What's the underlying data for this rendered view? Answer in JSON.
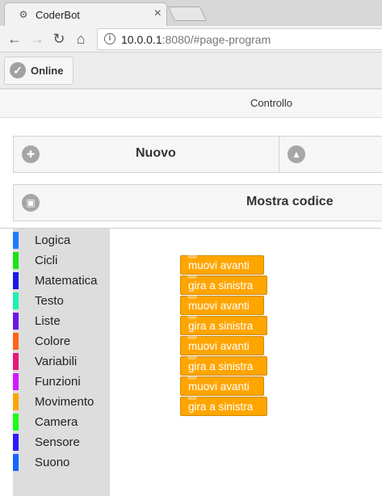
{
  "browser": {
    "tab_title": "CoderBot",
    "url_host": "10.0.0.1",
    "url_rest": ":8080/#page-program",
    "icons": [
      "back-arrow-icon",
      "forward-arrow-icon",
      "reload-icon",
      "home-icon",
      "info-icon",
      "close-icon"
    ]
  },
  "app": {
    "status_label": "Online",
    "tab_label": "Controllo",
    "buttons": {
      "new_label": "Nuovo",
      "show_code_label": "Mostra codice"
    }
  },
  "toolbox": {
    "categories": [
      {
        "label": "Logica",
        "color": "#1e7bff"
      },
      {
        "label": "Cicli",
        "color": "#18e418"
      },
      {
        "label": "Matematica",
        "color": "#1a1ae6"
      },
      {
        "label": "Testo",
        "color": "#1ef0b4"
      },
      {
        "label": "Liste",
        "color": "#6a18e6"
      },
      {
        "label": "Colore",
        "color": "#ff6418"
      },
      {
        "label": "Variabili",
        "color": "#e6187a"
      },
      {
        "label": "Funzioni",
        "color": "#d418ff"
      },
      {
        "label": "Movimento",
        "color": "#ffa500"
      },
      {
        "label": "Camera",
        "color": "#18ff18"
      },
      {
        "label": "Sensore",
        "color": "#3018ff"
      },
      {
        "label": "Suono",
        "color": "#1464ff"
      }
    ]
  },
  "program": {
    "blocks": [
      {
        "label": "muovi avanti"
      },
      {
        "label": "gira a sinistra"
      },
      {
        "label": "muovi avanti"
      },
      {
        "label": "gira a sinistra"
      },
      {
        "label": "muovi avanti"
      },
      {
        "label": "gira a sinistra"
      },
      {
        "label": "muovi avanti"
      },
      {
        "label": "gira a sinistra"
      }
    ],
    "block_color": "#ffa500"
  }
}
